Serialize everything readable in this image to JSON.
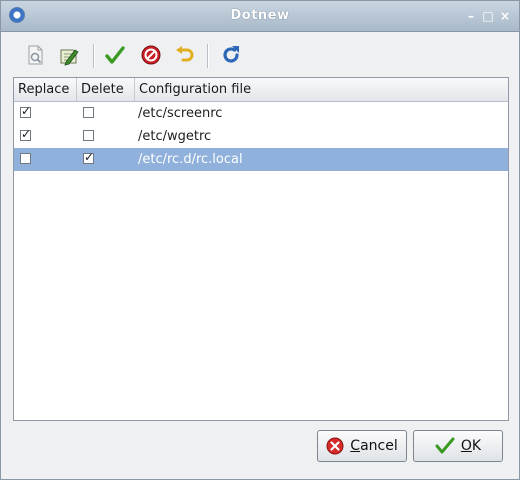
{
  "window": {
    "title": "Dotnew",
    "controls": {
      "minimize": "–",
      "maximize": "□",
      "close": "×"
    }
  },
  "toolbar": {
    "buttons": [
      {
        "name": "view-diff-icon"
      },
      {
        "name": "edit-icon"
      },
      {
        "name": "accept-icon",
        "color": "#3a9a22"
      },
      {
        "name": "reject-icon",
        "color": "#c81e24"
      },
      {
        "name": "undo-icon",
        "color": "#e0b020"
      },
      {
        "name": "refresh-icon",
        "color": "#2f67b8"
      }
    ]
  },
  "table": {
    "columns": [
      "Replace",
      "Delete",
      "Configuration file"
    ],
    "rows": [
      {
        "replace": true,
        "delete": false,
        "file": "/etc/screenrc",
        "selected": false
      },
      {
        "replace": true,
        "delete": false,
        "file": "/etc/wgetrc",
        "selected": false
      },
      {
        "replace": false,
        "delete": true,
        "file": "/etc/rc.d/rc.local",
        "selected": true
      }
    ]
  },
  "buttons": {
    "cancel": {
      "mnemonic": "C",
      "rest": "ancel"
    },
    "ok": {
      "mnemonic": "O",
      "rest": "K"
    }
  },
  "colors": {
    "selection": "#8fb1db",
    "cancel_icon": "#d42a2a",
    "ok_icon": "#3a9a22"
  }
}
